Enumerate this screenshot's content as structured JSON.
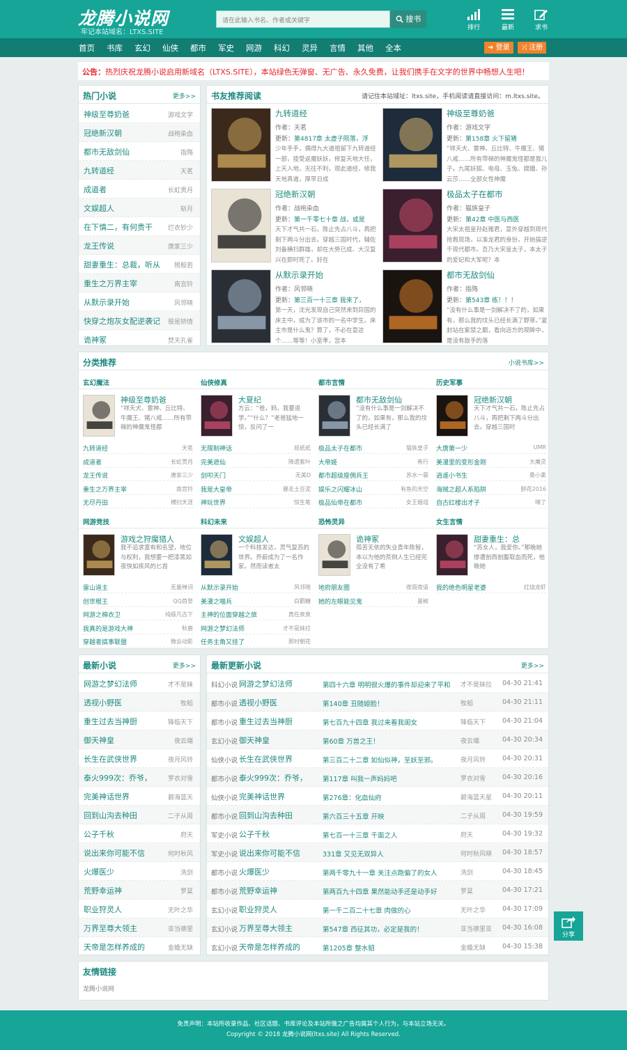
{
  "header": {
    "logo": "龙腾小说网",
    "logo_sub": "牢记本站域名：LTXS.SITE",
    "search_placeholder": "请在此输入书名、作者或关键字",
    "search_button": "搜书",
    "icons": [
      {
        "icon": "bar-chart-icon",
        "label": "排行"
      },
      {
        "icon": "menu-list-icon",
        "label": "最新"
      },
      {
        "icon": "edit-icon",
        "label": "求书"
      }
    ]
  },
  "nav": {
    "items": [
      "首页",
      "书库",
      "玄幻",
      "仙侠",
      "都市",
      "军史",
      "网游",
      "科幻",
      "灵异",
      "言情",
      "其他",
      "全本"
    ],
    "login": "登录",
    "register": "注册"
  },
  "notice": {
    "label": "公告：",
    "text": "热烈庆祝龙腾小说启用新域名（LTXS.SITE），本站绿色无弹窗、无广告、永久免费，让我们携手在文字的世界中畅想人生吧！"
  },
  "hot": {
    "title": "热门小说",
    "more": "更多>>",
    "items": [
      {
        "name": "神级至尊奶爸",
        "author": "游戏文字"
      },
      {
        "name": "冠绝新汉朝",
        "author": "战袍染血"
      },
      {
        "name": "都市无敌剑仙",
        "author": "指殇"
      },
      {
        "name": "九转道经",
        "author": "天茗"
      },
      {
        "name": "成道者",
        "author": "长虹贯月"
      },
      {
        "name": "文娱超人",
        "author": "斩月"
      },
      {
        "name": "在下慎二，有何贵干",
        "author": "烂衣钞少"
      },
      {
        "name": "龙王传说",
        "author": "唐家三少"
      },
      {
        "name": "甜妻重生：总裁，听从",
        "author": "殒般若"
      },
      {
        "name": "重生之万界主宰",
        "author": "南宫钤"
      },
      {
        "name": "从默示录开始",
        "author": "风邻晓"
      },
      {
        "name": "快穿之炮灰女配逆袭记",
        "author": "很是矫情"
      },
      {
        "name": "诡神冢",
        "author": "焚天孔雀"
      }
    ]
  },
  "recommend": {
    "title": "书友推荐阅读",
    "tip": "请记住本站域址：ltxs.site，手机阅读请直接访问：m.ltxs.site。",
    "books": [
      {
        "title": "九转道经",
        "author": "作者：天茗",
        "update_prefix": "更新：",
        "update": "第4817章 太虚子陨落，浮",
        "desc": "少年手手，偶得九大道祖留下九转道经一部，接受返魔妖妖，修复天地大任，上天入地，无往不利，观此道经，修我天地真道，厚早日成"
      },
      {
        "title": "神级至尊奶爸",
        "author": "作者：游戏文字",
        "update_prefix": "更新：",
        "update": "第158章 火下留猪",
        "desc": "“祥天犬、雷神、丘比特、牛魔王、猪八戒……所有带梯的神魔鬼怪都是我儿子。九尾妖狐、电母、玉兔、嫦娥、孙云莎……全部女性神魔"
      },
      {
        "title": "冠绝新汉朝",
        "author": "作者：战袍染血",
        "update_prefix": "更新：",
        "update": "第一千零七十章 战，或是",
        "desc": "天下才气共一石，陈止先占八斗，再把剩下两斗分出去。穿越三国时代，辅佐刘备横扫群雄，却在大势已成、大汉复兴在即时死了。好在"
      },
      {
        "title": "极品太子在都市",
        "author": "作者：猫族皇子",
        "update_prefix": "更新：",
        "update": "第42章 中医与西医",
        "desc": "大宋太祖皇孙赵雅君，意外穿越到现代抢救现场，以准龙君的身份，开始搞逆千现代都市。吾乃大宋皇太子，本太子的爱妃和大军呢？本"
      },
      {
        "title": "从默示录开始",
        "author": "作者：风邻晓",
        "update_prefix": "更新：",
        "update": "第三百一十三章 我来了，",
        "desc": "第一天，沈光发现自己突然来到异国的床主中，成为了该市的一名中学生。床主市是什么鬼？算了，不必在意这个……等等！小室孝，宫本"
      },
      {
        "title": "都市无敌剑仙",
        "author": "作者：指殇",
        "update_prefix": "更新：",
        "update": "第543章 练！！！",
        "desc": "“没有什么事是一剑解决不了的，如果有，那么我的坟头已经长满了野草。”夏封站在紫禁之巅，看向远方的观眸中，是没有敌手的落"
      }
    ]
  },
  "categories": {
    "title": "分类推荐",
    "more": "小说书库>>",
    "groups": [
      {
        "name": "玄幻魔法",
        "feature": {
          "title": "神级至尊奶爸",
          "desc": "“祥天犬、雷神、丘比特、牛魔王、猪八戒……所有带梯的神魔鬼怪都"
        },
        "items": [
          [
            "九转道经",
            "天茗"
          ],
          [
            "成道者",
            "长虹贯月"
          ],
          [
            "龙王传说",
            "唐家三少"
          ],
          [
            "重生之万界主宰",
            "南宫钤"
          ],
          [
            "无尽丹田",
            "横扫天涯"
          ]
        ]
      },
      {
        "name": "仙侠修真",
        "feature": {
          "title": "大夏纪",
          "desc": "方云：“爸，妈，我要退学。”“什么？”老爸猛地一惊，反问了一"
        },
        "items": [
          [
            "无限制神话",
            "屈纸纸"
          ],
          [
            "完美遮仙",
            "降遗紫叶"
          ],
          [
            "剑叩天门",
            "无美D"
          ],
          [
            "我是大皇帝",
            "暴走土豆泥"
          ],
          [
            "神玩世界",
            "惊生笔"
          ]
        ]
      },
      {
        "name": "都市言情",
        "feature": {
          "title": "都市无敌剑仙",
          "desc": "“没有什么事是一剑解决不了的，如果有，那么我的坟头已经长满了"
        },
        "items": [
          [
            "极品太子在都市",
            "猫族皇子"
          ],
          [
            "大帝姬",
            "希行"
          ],
          [
            "都市超级座佣兵王",
            "苏水一蓑"
          ],
          [
            "娱乐之闪耀冰山",
            "有鱼的天空"
          ],
          [
            "极品仙帝在都市",
            "女王婚俎"
          ]
        ]
      },
      {
        "name": "历史军事",
        "feature": {
          "title": "冠绝新汉朝",
          "desc": "天下才气共一石，陈止先占八斗，再把剩下两斗分出去。穿越三国时"
        },
        "items": [
          [
            "大唐第一少",
            "UMR"
          ],
          [
            "美漫里的变形金刚",
            "大魔灵"
          ],
          [
            "逍遥小书生",
            "桑小柔"
          ],
          [
            "海贼之超人系陷阱",
            "醉花2016"
          ],
          [
            "自古红楼出才子",
            "晴了"
          ]
        ]
      },
      {
        "name": "网游竞技",
        "feature": {
          "title": "游戏之狩魔猎人",
          "desc": "我不追求富有和名望，地位与权利，我想要一把漆黑如夜快如疾风的匕首"
        },
        "items": [
          [
            "雷山道主",
            "无量禅词"
          ],
          [
            "创世棍王",
            "QQ首誉"
          ],
          [
            "网游之棉衣卫",
            "纯级凡古下"
          ],
          [
            "我真的是游戏大神",
            "秋鹿"
          ],
          [
            "穿越者搞事联盟",
            "微云动影"
          ]
        ]
      },
      {
        "name": "科幻未来",
        "feature": {
          "title": "文娱超人",
          "desc": "一个科技发达，灵气复苏的世界。乔蔚成为了一名作家。然而读者太"
        },
        "items": [
          [
            "从默示录开始",
            "风邻晓"
          ],
          [
            "美漫之喵兵",
            "白鹳糖"
          ],
          [
            "主神的位面穿越之旅",
            "真任泉泉"
          ],
          [
            "网游之梦幻法师",
            "才不是妹拉"
          ],
          [
            "任务主角又挂了",
            "那时朝花"
          ]
        ]
      },
      {
        "name": "恐怖灵异",
        "feature": {
          "title": "诡神冢",
          "desc": "孤苦无依的失业青年陈智，本以为他的荒倒人生已经完全没有了希"
        },
        "items": [
          [
            "地府朋友圈",
            "夜雨夜语"
          ],
          [
            "她的左眼能见鬼",
            "墨椒"
          ]
        ]
      },
      {
        "name": "女生言情",
        "feature": {
          "title": "甜妻重生：总",
          "desc": "“苏女人，我爱你。”那晚她惨遭剖西剖腹取血而死，他晚她"
        },
        "items": [
          [
            "我的绝色明星老婆",
            "红烧龙虾"
          ]
        ]
      }
    ]
  },
  "latest": {
    "title": "最新小说",
    "more": "更多>>",
    "items": [
      {
        "name": "网游之梦幻法师",
        "author": "才不是妹"
      },
      {
        "name": "透视小野医",
        "author": "牧稻"
      },
      {
        "name": "重生过去当神厨",
        "author": "锋临天下"
      },
      {
        "name": "御天神皇",
        "author": "夜云端"
      },
      {
        "name": "长生在武侠世界",
        "author": "夜月风铃"
      },
      {
        "name": "泰火999次：乔爷，",
        "author": "罗衣对雪"
      },
      {
        "name": "完美神话世界",
        "author": "碧海蓝天"
      },
      {
        "name": "回到山沟去种田",
        "author": "二子从周"
      },
      {
        "name": "公子千秋",
        "author": "府天"
      },
      {
        "name": "说出来你可能不信",
        "author": "何时秋风"
      },
      {
        "name": "火爆医少",
        "author": "洗剑"
      },
      {
        "name": "荒野幸运神",
        "author": "罗棻"
      },
      {
        "name": "职业狩灵人",
        "author": "无叶之华"
      },
      {
        "name": "万界至尊大领主",
        "author": "亚当德里"
      },
      {
        "name": "天帝是怎样养成的",
        "author": "金蟾无缺"
      }
    ]
  },
  "updates": {
    "title": "最新更新小说",
    "more": "更多>>",
    "rows": [
      {
        "cat": "科幻小说",
        "book": "网游之梦幻法师",
        "chapter": "第四十六章 明明很火爆的事件却迎来了平和",
        "author": "才不是妹拉",
        "time": "04-30 21:41"
      },
      {
        "cat": "都市小说",
        "book": "透视小野医",
        "chapter": "第140章 丑随媳脸！",
        "author": "牧稻",
        "time": "04-30 21:11"
      },
      {
        "cat": "都市小说",
        "book": "重生过去当神厨",
        "chapter": "第七百九十四章 我过来看我闺女",
        "author": "锋临天下",
        "time": "04-30 21:04"
      },
      {
        "cat": "玄幻小说",
        "book": "御天神皇",
        "chapter": "第60章 万兽之王！",
        "author": "夜云端",
        "time": "04-30 20:34"
      },
      {
        "cat": "仙侠小说",
        "book": "长生在武侠世界",
        "chapter": "第三百二十二章 如仙似神，至妖至邪。",
        "author": "夜月风铃",
        "time": "04-30 20:31"
      },
      {
        "cat": "都市小说",
        "book": "泰火999次：乔爷，",
        "chapter": "第117章 叫我一声妈妈吧",
        "author": "罗衣对雪",
        "time": "04-30 20:16"
      },
      {
        "cat": "仙侠小说",
        "book": "完美神话世界",
        "chapter": "第276章：化血仙府",
        "author": "碧海蓝天星",
        "time": "04-30 20:11"
      },
      {
        "cat": "都市小说",
        "book": "回到山沟去种田",
        "chapter": "第六百三十五章 开映",
        "author": "二子从周",
        "time": "04-30 19:59"
      },
      {
        "cat": "军史小说",
        "book": "公子千秋",
        "chapter": "第七百一十三章 千面之人",
        "author": "府天",
        "time": "04-30 19:32"
      },
      {
        "cat": "军史小说",
        "book": "说出来你可能不信",
        "chapter": "331章 又见无双异人",
        "author": "何时秋风晓",
        "time": "04-30 18:57"
      },
      {
        "cat": "都市小说",
        "book": "火爆医少",
        "chapter": "第两千零九十一章 关注点跑偏了的女人",
        "author": "洗剑",
        "time": "04-30 18:45"
      },
      {
        "cat": "都市小说",
        "book": "荒野幸运神",
        "chapter": "第两百九十四章 果然能动手还是动手好",
        "author": "罗棻",
        "time": "04-30 17:21"
      },
      {
        "cat": "玄幻小说",
        "book": "职业狩灵人",
        "chapter": "第一千二百二十七章 肉做的心",
        "author": "无叶之华",
        "time": "04-30 17:09"
      },
      {
        "cat": "玄幻小说",
        "book": "万界至尊大领主",
        "chapter": "第547章 西征其功，必定是我的！",
        "author": "亚当德里亚",
        "time": "04-30 16:08"
      },
      {
        "cat": "玄幻小说",
        "book": "天帝是怎样养成的",
        "chapter": "第1205章 整水貂",
        "author": "金蟾无缺",
        "time": "04-30 15:38"
      }
    ]
  },
  "links": {
    "title": "友情链接",
    "items": [
      "龙腾小说网"
    ]
  },
  "footer": {
    "line1": "免责声明：本站所收录作品、社区话题、书库评论及本站所做之广告均属其个人行为，与本站立场无关。",
    "line2": "Copyright © 2018 龙腾小说网(ltxs.site) All Rights Reserved."
  },
  "share": {
    "label": "分享"
  },
  "colors": {
    "primary": "#16a597",
    "nav": "#127d72",
    "accent": "#f0832b",
    "notice": "#e6232a"
  }
}
